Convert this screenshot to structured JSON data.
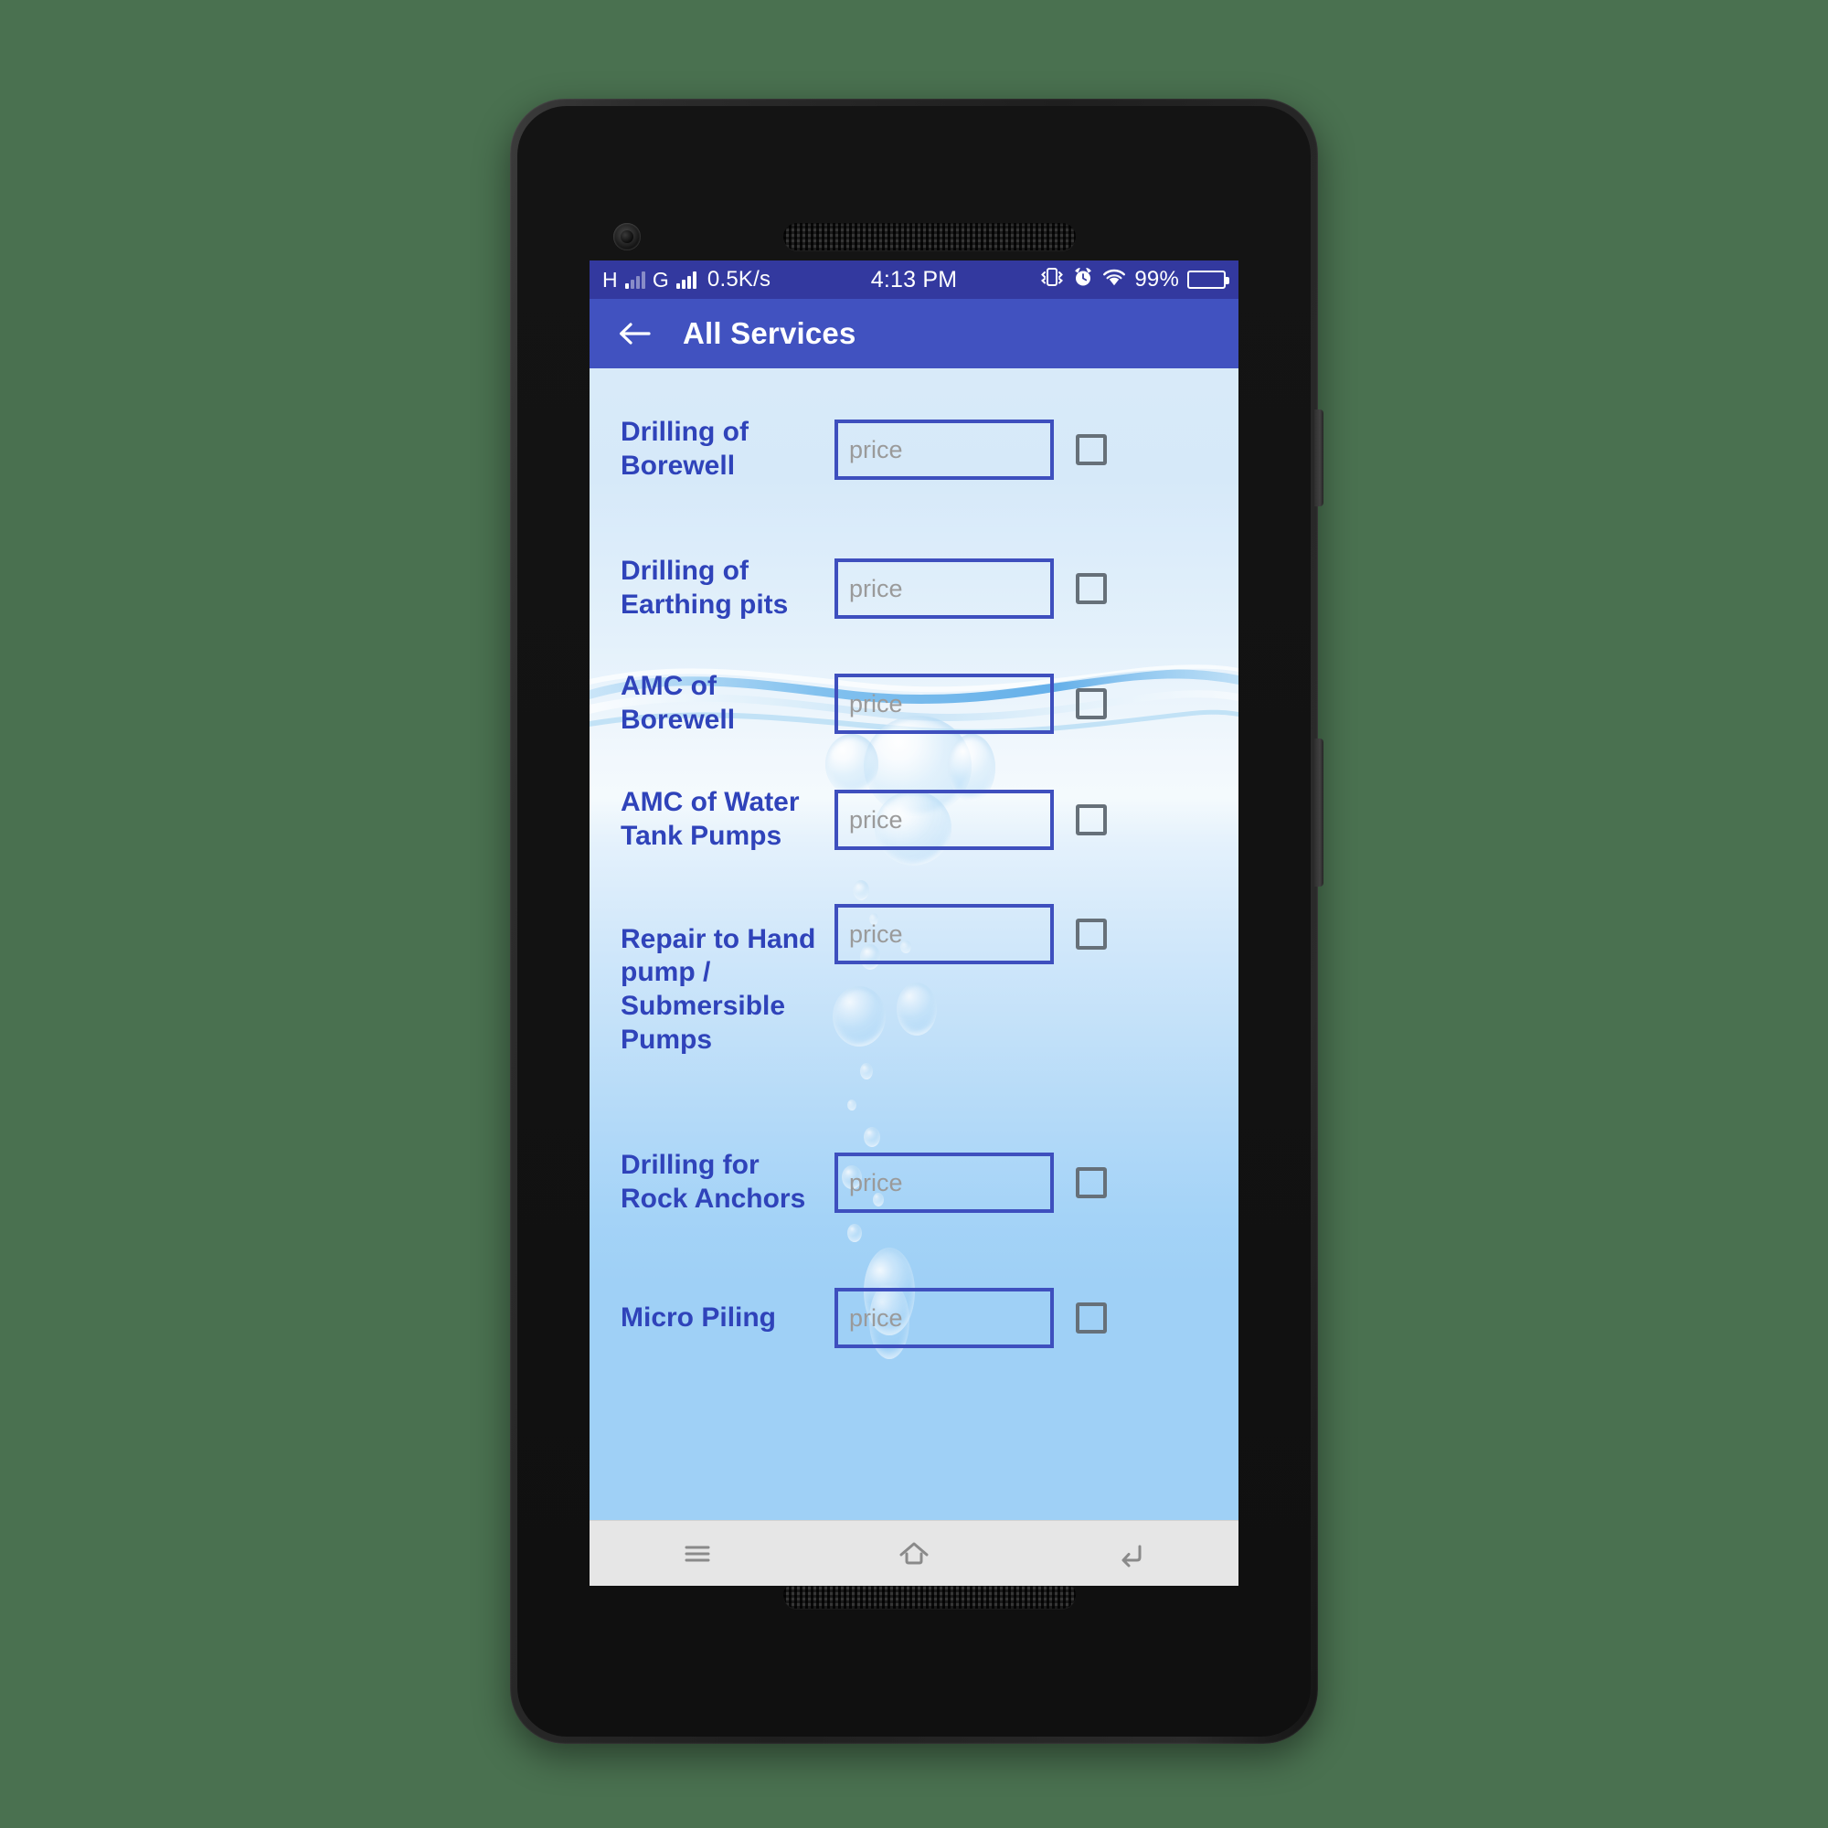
{
  "device": {
    "frame_color": "#222222",
    "stage_background": "#4a7150"
  },
  "status_bar": {
    "background": "#33399f",
    "network_type_1": "H",
    "network_type_2": "G",
    "data_speed": "0.5K/s",
    "time": "4:13 PM",
    "battery_percent": "99%",
    "icons": [
      "signal-bars-icon",
      "signal-bars-icon",
      "vibrate-icon",
      "alarm-clock-icon",
      "wifi-icon",
      "battery-icon"
    ]
  },
  "app_bar": {
    "background": "#4152c0",
    "back_label": "back-arrow-icon",
    "title": "All Services"
  },
  "content": {
    "accent_border": "#3e4fbe",
    "label_color": "#2f43ba",
    "placeholder_color": "#9a9a9a",
    "checkbox_border": "#667079",
    "price_placeholder": "price",
    "services": [
      {
        "name": "Drilling of Borewell",
        "price_value": "",
        "checked": false
      },
      {
        "name": "Drilling of Earthing pits",
        "price_value": "",
        "checked": false
      },
      {
        "name": "AMC of Borewell",
        "price_value": "",
        "checked": false
      },
      {
        "name": "AMC of Water Tank Pumps",
        "price_value": "",
        "checked": false
      },
      {
        "name": "Repair to Hand pump / Submersible Pumps",
        "price_value": "",
        "checked": false
      },
      {
        "name": "Drilling for Rock Anchors",
        "price_value": "",
        "checked": false
      },
      {
        "name": "Micro Piling",
        "price_value": "",
        "checked": false
      }
    ]
  },
  "nav_bar": {
    "background": "#e6e6e6",
    "items": [
      {
        "icon": "menu-icon",
        "label": "Menu"
      },
      {
        "icon": "home-icon",
        "label": "Home"
      },
      {
        "icon": "back-icon",
        "label": "Back"
      }
    ]
  }
}
